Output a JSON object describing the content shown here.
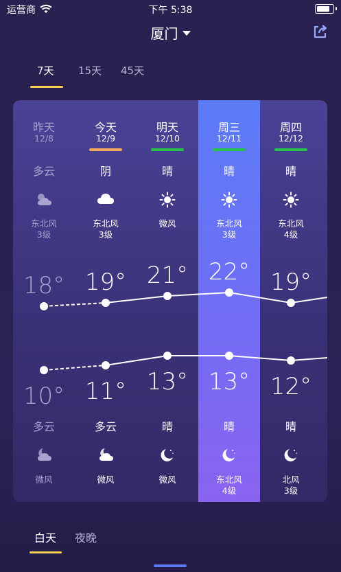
{
  "status_bar": {
    "carrier": "运营商",
    "time": "下午 5:38"
  },
  "header": {
    "city": "厦门"
  },
  "range_tabs": [
    {
      "label": "7天",
      "active": true
    },
    {
      "label": "15天",
      "active": false
    },
    {
      "label": "45天",
      "active": false
    }
  ],
  "days": [
    {
      "name": "昨天",
      "date": "12/8",
      "day_condition": "多云",
      "day_icon": "partly-cloudy-sun-icon",
      "day_wind": "东北风",
      "day_wind_level": "3级",
      "high": 18,
      "high_label": "18°",
      "low": 10,
      "low_label": "10°",
      "night_condition": "多云",
      "night_icon": "cloudy-moon-icon",
      "night_wind": "微风",
      "night_wind_level": "",
      "bar_color": "",
      "dimmed": true
    },
    {
      "name": "今天",
      "date": "12/9",
      "day_condition": "阴",
      "day_icon": "cloud-icon",
      "day_wind": "东北风",
      "day_wind_level": "3级",
      "high": 19,
      "high_label": "19°",
      "low": 11,
      "low_label": "11°",
      "night_condition": "多云",
      "night_icon": "cloudy-moon-icon",
      "night_wind": "微风",
      "night_wind_level": "",
      "bar_color": "#f2a65a",
      "dimmed": false
    },
    {
      "name": "明天",
      "date": "12/10",
      "day_condition": "晴",
      "day_icon": "sun-icon",
      "day_wind": "微风",
      "day_wind_level": "",
      "high": 21,
      "high_label": "21°",
      "low": 13,
      "low_label": "13°",
      "night_condition": "晴",
      "night_icon": "moon-icon",
      "night_wind": "微风",
      "night_wind_level": "",
      "bar_color": "#27c24c",
      "dimmed": false
    },
    {
      "name": "周三",
      "date": "12/11",
      "day_condition": "晴",
      "day_icon": "sun-icon",
      "day_wind": "东北风",
      "day_wind_level": "3级",
      "high": 22,
      "high_label": "22°",
      "low": 13,
      "low_label": "13°",
      "night_condition": "晴",
      "night_icon": "moon-icon",
      "night_wind": "东北风",
      "night_wind_level": "4级",
      "bar_color": "#27c24c",
      "dimmed": false
    },
    {
      "name": "周四",
      "date": "12/12",
      "day_condition": "晴",
      "day_icon": "sun-icon",
      "day_wind": "东北风",
      "day_wind_level": "4级",
      "high": 19,
      "high_label": "19°",
      "low": 12,
      "low_label": "12°",
      "night_condition": "晴",
      "night_icon": "moon-icon",
      "night_wind": "北风",
      "night_wind_level": "3级",
      "bar_color": "#27c24c",
      "dimmed": false
    }
  ],
  "bottom_tabs": [
    {
      "label": "白天",
      "active": true
    },
    {
      "label": "夜晚",
      "active": false
    }
  ],
  "colors": {
    "accent": "#f5d251",
    "highlight_top": "#5b7cf6",
    "highlight_bottom": "#8a63f0"
  }
}
